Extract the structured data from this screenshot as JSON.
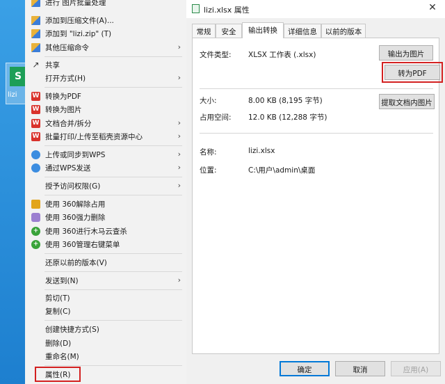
{
  "desktop": {
    "file_label": "lizi",
    "file_badge": "S"
  },
  "context_menu": {
    "items": [
      {
        "label": "进行 图片批量处理",
        "icon": "image-batch-icon"
      },
      {
        "label": "添加到压缩文件(A)...",
        "icon": "archive-icon"
      },
      {
        "label": "添加到 \"lizi.zip\" (T)",
        "icon": "archive-icon"
      },
      {
        "label": "其他压缩命令",
        "icon": "archive-icon",
        "submenu": true
      },
      {
        "label": "共享",
        "icon": "share-icon"
      },
      {
        "label": "打开方式(H)",
        "submenu": true
      },
      {
        "label": "转换为PDF",
        "icon": "wps-icon"
      },
      {
        "label": "转换为图片",
        "icon": "wps-icon"
      },
      {
        "label": "文档合并/拆分",
        "icon": "wps-icon",
        "submenu": true
      },
      {
        "label": "批量打印/上传至稻壳资源中心",
        "icon": "wps-icon",
        "submenu": true
      },
      {
        "label": "上传或同步到WPS",
        "icon": "cloud-icon",
        "submenu": true
      },
      {
        "label": "通过WPS发送",
        "icon": "cloud-icon",
        "submenu": true
      },
      {
        "label": "授予访问权限(G)",
        "submenu": true
      },
      {
        "label": "使用 360解除占用",
        "icon": "360-unlock-icon"
      },
      {
        "label": "使用 360强力删除",
        "icon": "360-delete-icon"
      },
      {
        "label": "使用 360进行木马云查杀",
        "icon": "360-scan-icon"
      },
      {
        "label": "使用 360管理右键菜单",
        "icon": "360-scan-icon"
      },
      {
        "label": "还原以前的版本(V)"
      },
      {
        "label": "发送到(N)",
        "submenu": true
      },
      {
        "label": "剪切(T)"
      },
      {
        "label": "复制(C)"
      },
      {
        "label": "创建快捷方式(S)"
      },
      {
        "label": "删除(D)"
      },
      {
        "label": "重命名(M)"
      },
      {
        "label": "属性(R)"
      }
    ]
  },
  "dialog": {
    "title": "lizi.xlsx 属性",
    "tabs": [
      "常规",
      "安全",
      "输出转换",
      "详细信息",
      "以前的版本"
    ],
    "active_tab": "输出转换",
    "file_type_label": "文件类型:",
    "file_type_value": "XLSX 工作表 (.xlsx)",
    "export_image_button": "输出为图片",
    "to_pdf_button": "转为PDF",
    "size_label": "大小:",
    "size_value": "8.00 KB (8,195 字节)",
    "disk_label": "占用空间:",
    "disk_value": "12.0 KB (12,288 字节)",
    "extract_images_button": "提取文档内图片",
    "name_label": "名称:",
    "name_value": "lizi.xlsx",
    "location_label": "位置:",
    "location_value": "C:\\用户\\admin\\桌面",
    "ok_button": "确定",
    "cancel_button": "取消",
    "apply_button": "应用(A)"
  },
  "colors": {
    "highlight": "#d32020",
    "primary_border": "#0078d7"
  }
}
